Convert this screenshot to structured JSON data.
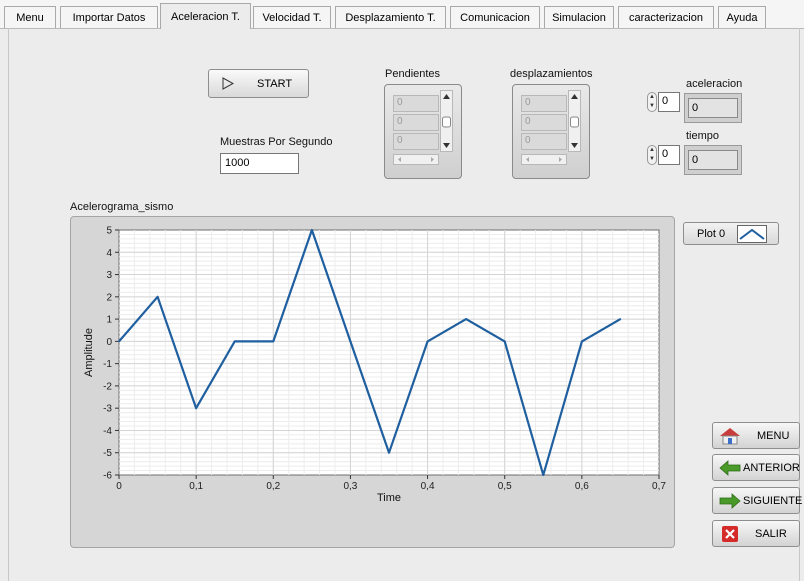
{
  "tabs": [
    {
      "label": "Menu",
      "active": false
    },
    {
      "label": "Importar Datos",
      "active": false
    },
    {
      "label": "Aceleracion T.",
      "active": true
    },
    {
      "label": "Velocidad T.",
      "active": false
    },
    {
      "label": "Desplazamiento T.",
      "active": false
    },
    {
      "label": "Comunicacion",
      "active": false
    },
    {
      "label": "Simulacion",
      "active": false
    },
    {
      "label": "caracterizacion",
      "active": false
    },
    {
      "label": "Ayuda",
      "active": false
    }
  ],
  "start_button": {
    "label": "START",
    "icon": "play-outline-icon"
  },
  "samples": {
    "label": "Muestras Por Segundo",
    "value": "1000"
  },
  "pendientes": {
    "label": "Pendientes",
    "cells": [
      "0",
      "0",
      "0"
    ]
  },
  "desplazamientos": {
    "label": "desplazamientos",
    "cells": [
      "0",
      "0",
      "0"
    ]
  },
  "aceleracion": {
    "label": "aceleracion",
    "index": "0",
    "value": "0"
  },
  "tiempo": {
    "label": "tiempo",
    "index": "0",
    "value": "0"
  },
  "legend": {
    "label": "Plot 0"
  },
  "nav": {
    "menu": {
      "label": "MENU",
      "icon": "home-icon"
    },
    "anterior": {
      "label": "ANTERIOR",
      "icon": "arrow-left-icon"
    },
    "siguiente": {
      "label": "SIGUIENTE",
      "icon": "arrow-right-icon"
    },
    "salir": {
      "label": "SALIR",
      "icon": "close-x-icon"
    }
  },
  "colors": {
    "plot_line": "#1f5f9f",
    "salir_icon": "#d42a2a",
    "nav_arrow": "#4a9a2a"
  },
  "chart_data": {
    "type": "line",
    "title": "Acelerograma_sismo",
    "xlabel": "Time",
    "ylabel": "Amplitude",
    "xlim": [
      0,
      0.7
    ],
    "ylim": [
      -6,
      5
    ],
    "xticks": [
      "0",
      "0,1",
      "0,2",
      "0,3",
      "0,4",
      "0,5",
      "0,6",
      "0,7"
    ],
    "yticks": [
      "5",
      "4",
      "3",
      "2",
      "1",
      "0",
      "-1",
      "-2",
      "-3",
      "-4",
      "-5",
      "-6"
    ],
    "grid": true,
    "series": [
      {
        "name": "Plot 0",
        "x": [
          0,
          0.05,
          0.1,
          0.15,
          0.2,
          0.25,
          0.3,
          0.35,
          0.4,
          0.45,
          0.5,
          0.55,
          0.6,
          0.65
        ],
        "y": [
          0,
          2,
          -3,
          0,
          0,
          5,
          0,
          -5,
          0,
          1,
          0,
          -6,
          0,
          1
        ]
      }
    ]
  }
}
